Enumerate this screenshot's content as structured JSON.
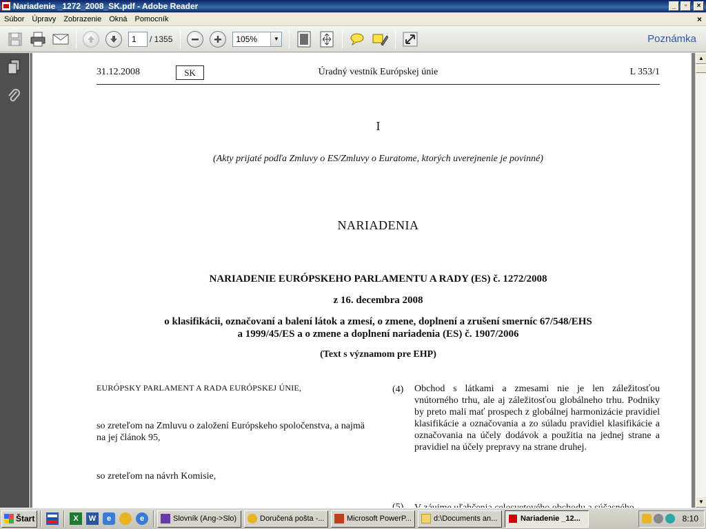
{
  "window": {
    "title": "Nariadenie _1272_2008_SK.pdf - Adobe Reader",
    "min": "_",
    "max": "▫",
    "close": "×"
  },
  "menu": {
    "items": [
      "Súbor",
      "Úpravy",
      "Zobrazenie",
      "Okná",
      "Pomocník"
    ],
    "close": "×"
  },
  "toolbar": {
    "page_current": "1",
    "page_total": "/ 1355",
    "zoom": "105%",
    "zoom_arrow": "▼",
    "comment_label": "Poznámka"
  },
  "document": {
    "header": {
      "date": "31.12.2008",
      "lang": "SK",
      "journal": "Úradný vestník Európskej únie",
      "ref": "L 353/1"
    },
    "roman": "I",
    "acts": "(Akty prijaté podľa Zmluvy o ES/Zmluvy o Euratome, ktorých uverejnenie je povinné)",
    "section": "NARIADENIA",
    "reg_title": "NARIADENIE EURÓPSKEHO PARLAMENTU A RADY (ES) č. 1272/2008",
    "reg_date": "z 16. decembra 2008",
    "reg_subject_1": "o klasifikácii, označovaní a balení látok a zmesí, o zmene, doplnení a zrušení smerníc 67/548/EHS",
    "reg_subject_2": "a 1999/45/ES a o zmene a doplnení nariadenia (ES) č. 1907/2006",
    "eea": "(Text s významom pre EHP)",
    "left_1": "EURÓPSKY PARLAMENT A RADA EURÓPSKEJ ÚNIE,",
    "left_2": "so zreteľom na Zmluvu o založení Európskeho spoločenstva, a najmä na jej článok 95,",
    "left_3": "so zreteľom na návrh Komisie,",
    "recital_4_num": "(4)",
    "recital_4_text": "Obchod s látkami a zmesami nie je len záležitosťou vnútorného trhu, ale aj záležitosťou globálneho trhu. Podniky by preto mali mať prospech z globálnej harmonizácie pravidiel klasifikácie a označovania a zo súladu pravidiel klasifikácie a označovania na účely dodávok a použitia na jednej strane a pravidiel na účely prepravy na strane druhej.",
    "recital_5_num": "(5)",
    "recital_5_text": "V záujme uľahčenia celosvetového obchodu a súčasného"
  },
  "scrollbar": {
    "up": "▲",
    "down": "▼"
  },
  "taskbar": {
    "start": "Štart",
    "tasks": [
      "Slovník (Ang->Slo)",
      "Doručená pošta -...",
      "Microsoft PowerP...",
      "d:\\Documents an...",
      "Nariadenie _12..."
    ],
    "clock": "8:10"
  }
}
